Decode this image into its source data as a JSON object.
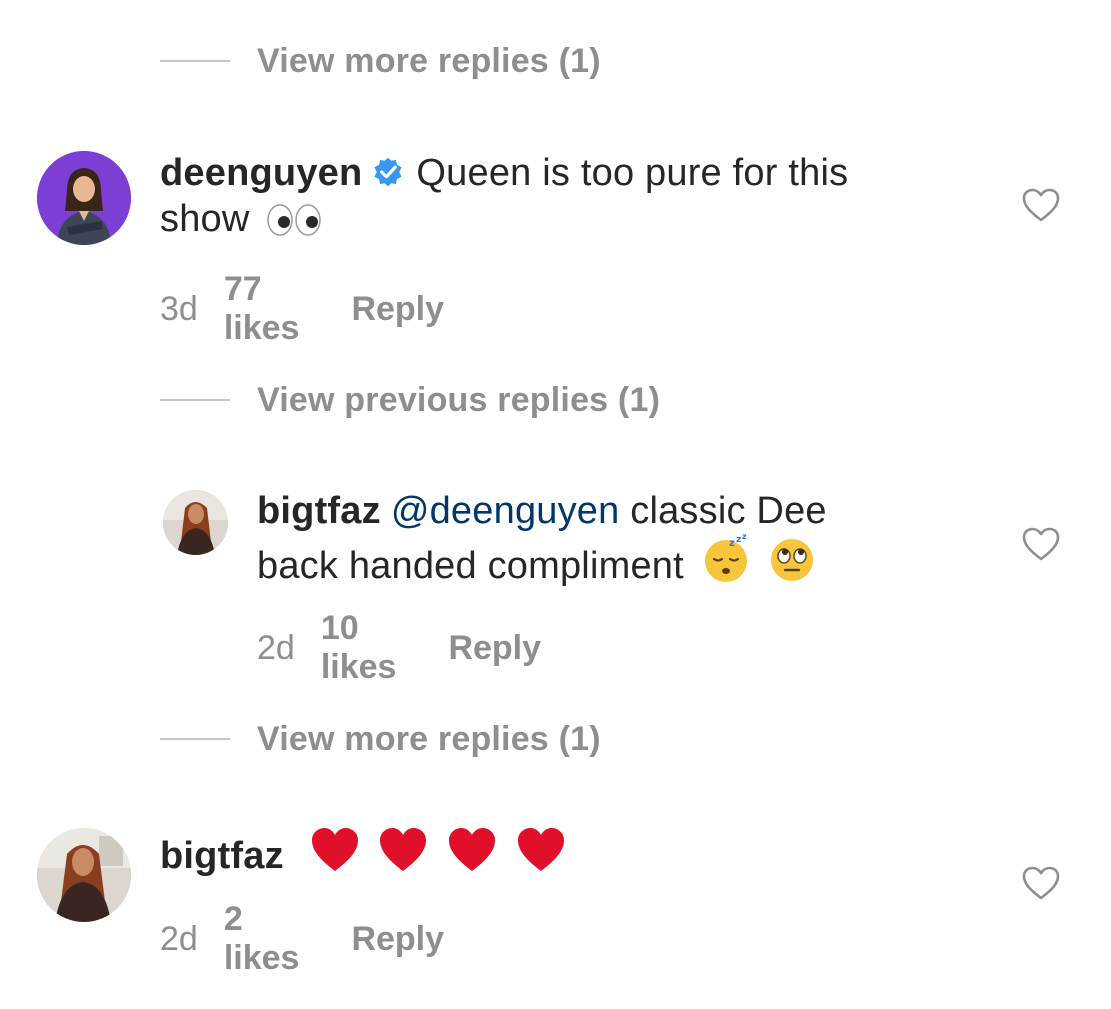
{
  "threads": {
    "view_more_1": "View more replies (1)",
    "view_previous": "View previous replies (1)",
    "view_more_2": "View more replies (1)"
  },
  "comments": [
    {
      "username": "deenguyen",
      "verified": true,
      "text": "Queen is too pure for this",
      "text_line2": "show",
      "time": "3d",
      "likes": "77 likes",
      "reply": "Reply",
      "emojis": [
        "eyes-emoji"
      ]
    },
    {
      "username": "bigtfaz",
      "mention": "@deenguyen",
      "text": "classic Dee",
      "text_line2": "back handed compliment",
      "time": "2d",
      "likes": "10 likes",
      "reply": "Reply",
      "emojis": [
        "sleeping-face-emoji",
        "eye-roll-emoji"
      ]
    },
    {
      "username": "bigtfaz",
      "text": "",
      "time": "2d",
      "likes": "2 likes",
      "reply": "Reply",
      "emojis": [
        "red-heart-emoji",
        "red-heart-emoji",
        "red-heart-emoji",
        "red-heart-emoji"
      ]
    }
  ],
  "colors": {
    "text": "#262626",
    "secondary": "#8e8e8e",
    "mention": "#00376b",
    "verified": "#3897f0",
    "heart": "#e0102b",
    "divider": "#c7c7c7"
  }
}
